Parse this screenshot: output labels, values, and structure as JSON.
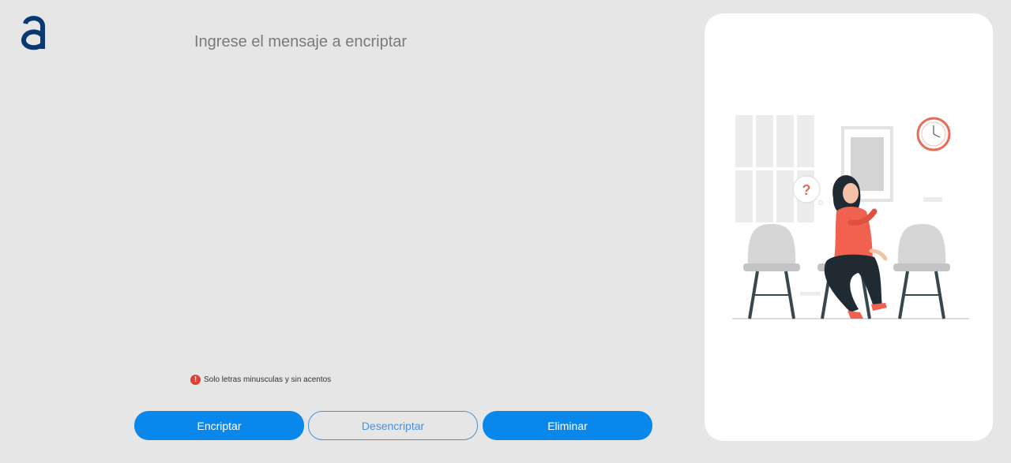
{
  "logo": {
    "letter": "a"
  },
  "input": {
    "placeholder": "Ingrese el mensaje a encriptar",
    "value": ""
  },
  "hint": {
    "icon": "alert-icon",
    "text": "Solo letras minusculas y sin acentos"
  },
  "buttons": {
    "encrypt_label": "Encriptar",
    "decrypt_label": "Desencriptar",
    "delete_label": "Eliminar"
  },
  "illustration": {
    "question_mark": "?"
  },
  "colors": {
    "background": "#e6e6e6",
    "primary": "#0a87ea",
    "logo": "#0a3871",
    "alert": "#e0403b",
    "accent": "#f0624f"
  }
}
